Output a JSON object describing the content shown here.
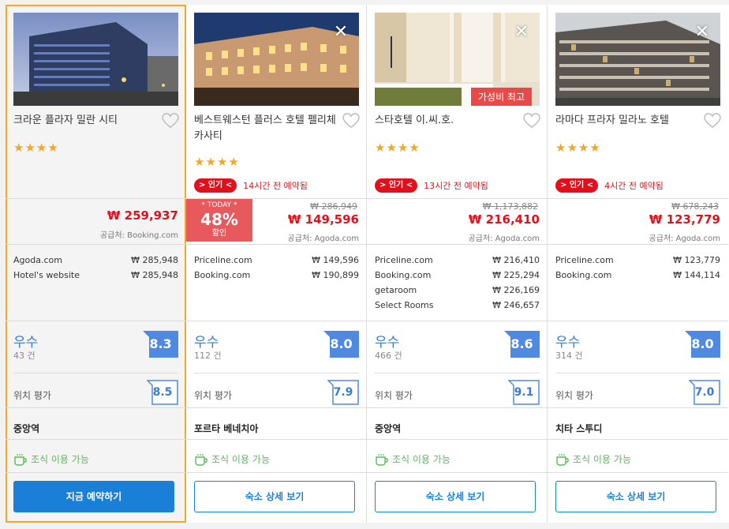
{
  "hotels": [
    {
      "name": "크라운 플라자 밀란 시티",
      "stars": "★★★★",
      "has_close": false,
      "value_badge": "",
      "popular": null,
      "deal": null,
      "orig_price": "",
      "price": "₩ 259,937",
      "supplier": "공급처: Booking.com",
      "otas": [
        {
          "name": "Agoda.com",
          "price": "₩  285,948"
        },
        {
          "name": "Hotel's website",
          "price": "₩  285,948"
        }
      ],
      "rating_word": "우수",
      "reviews": "43 건",
      "score": "8.3",
      "location_label": "위치 평가",
      "location_score": "8.5",
      "area": "중앙역",
      "breakfast": "조식 이용 가능",
      "button": "지금 예약하기",
      "button_style": "primary"
    },
    {
      "name": "베스트웨스턴 플러스 호텔 펠리체 카사티",
      "stars": "★★★★",
      "has_close": true,
      "value_badge": "",
      "popular": {
        "tag": "> 인기 <",
        "text": "14시간 전 예약됨"
      },
      "deal": {
        "today": "* TODAY *",
        "pct": "48%",
        "off": "할인"
      },
      "orig_price": "₩ 286,949",
      "price": "₩ 149,596",
      "supplier": "공급처: Agoda.com",
      "otas": [
        {
          "name": "Priceline.com",
          "price": "₩  149,596"
        },
        {
          "name": "Booking.com",
          "price": "₩  190,899"
        }
      ],
      "rating_word": "우수",
      "reviews": "112 건",
      "score": "8.0",
      "location_label": "위치 평가",
      "location_score": "7.9",
      "area": "포르타 베네치아",
      "breakfast": "조식 이용 가능",
      "button": "숙소 상세 보기",
      "button_style": "outline"
    },
    {
      "name": "스타호텔 이.씨.호.",
      "stars": "★★★★",
      "has_close": true,
      "value_badge": "가성비 최고",
      "popular": {
        "tag": "> 인기 <",
        "text": "13시간 전 예약됨"
      },
      "deal": null,
      "orig_price": "₩ 1,173,882",
      "price": "₩ 216,410",
      "supplier": "공급처: Agoda.com",
      "otas": [
        {
          "name": "Priceline.com",
          "price": "₩  216,410"
        },
        {
          "name": "Booking.com",
          "price": "₩  225,294"
        },
        {
          "name": "getaroom",
          "price": "₩  226,169"
        },
        {
          "name": "Select Rooms",
          "price": "₩  246,657"
        }
      ],
      "rating_word": "우수",
      "reviews": "466 건",
      "score": "8.6",
      "location_label": "위치 평가",
      "location_score": "9.1",
      "area": "중앙역",
      "breakfast": "조식 이용 가능",
      "button": "숙소 상세 보기",
      "button_style": "outline"
    },
    {
      "name": "라마다 프라자 밀라노 호텔",
      "stars": "★★★★",
      "has_close": true,
      "value_badge": "",
      "popular": {
        "tag": "> 인기 <",
        "text": "4시간 전 예약됨"
      },
      "deal": null,
      "orig_price": "₩ 678,243",
      "price": "₩ 123,779",
      "supplier": "공급처: Agoda.com",
      "otas": [
        {
          "name": "Priceline.com",
          "price": "₩  123,779"
        },
        {
          "name": "Booking.com",
          "price": "₩  144,114"
        }
      ],
      "rating_word": "우수",
      "reviews": "314 건",
      "score": "8.0",
      "location_label": "위치 평가",
      "location_score": "7.0",
      "area": "치타 스투디",
      "breakfast": "조식 이용 가능",
      "button": "숙소 상세 보기",
      "button_style": "outline"
    }
  ],
  "colors": {
    "accent": "#1a7fd6",
    "price_red": "#e3101c",
    "star": "#f5a623",
    "score_blue": "#3a7bd5",
    "breakfast_green": "#5cb85c",
    "selected_border": "#f5a623"
  }
}
